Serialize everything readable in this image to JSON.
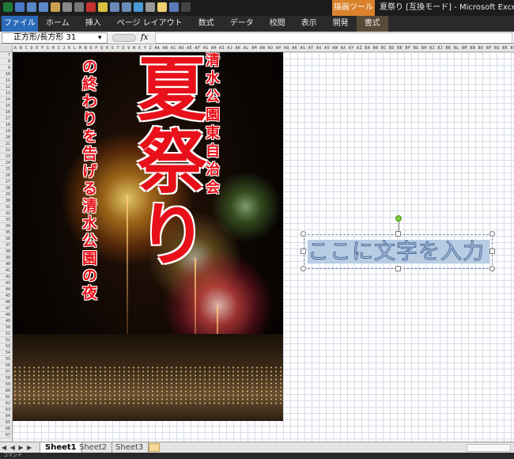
{
  "titlebar": {
    "context_group": "描画ツール",
    "window_title": "夏祭り [互換モード] - Microsoft Excel"
  },
  "ribbon": {
    "tabs": [
      {
        "label": "ファイル"
      },
      {
        "label": "ホーム"
      },
      {
        "label": "挿入"
      },
      {
        "label": "ページ レイアウト"
      },
      {
        "label": "数式"
      },
      {
        "label": "データ"
      },
      {
        "label": "校閲"
      },
      {
        "label": "表示"
      },
      {
        "label": "開発"
      },
      {
        "label": "書式"
      }
    ]
  },
  "formula_bar": {
    "name_box": "正方形/長方形 31",
    "fx_label": "fx",
    "value": ""
  },
  "grid": {
    "column_letters": "A B C D E F G H I J K L M N O P Q R S T U V W X Y Z AA AB AC AD AE AF AG AH AI AJ AK AL AM AN AO AP AQ AR AS AT AU AV AW AX AY AZ BA BB BC BD BE BF BG BH BI BJ BK BL BM BN BO BP BQ BR BS BT BU BV",
    "row_start": 7,
    "row_end": 67
  },
  "poster": {
    "title": "夏祭り",
    "subtitle_left": "の終わりを告げる清水公園の夜",
    "subtitle_right": "清水公園東自治会"
  },
  "textbox": {
    "text": "ここに文字を入力"
  },
  "sheets": {
    "nav_arrows": "◀ ◀ ▶ ▶",
    "tabs": [
      "Sheet1",
      "Sheet2",
      "Sheet3"
    ],
    "active": "Sheet1"
  },
  "status": {
    "text": "コマンド"
  },
  "colors": {
    "accent": "#2a6bb8",
    "context_group": "#d9822b",
    "poster_text": "#e8101a",
    "selection_fill": "#b8cce4"
  }
}
